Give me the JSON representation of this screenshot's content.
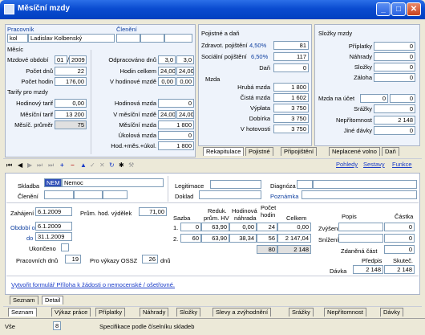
{
  "window": {
    "title": "Měsíční mzdy"
  },
  "top": {
    "pracovnik_label": "Pracovník",
    "cleneni_label": "Členění",
    "kod": "kol",
    "jmeno": "Ladislav Kolbenský",
    "mesic_label": "Měsíc",
    "mzdove_obdobi_label": "Mzdové období",
    "obdobi_mesic": "01",
    "obdobi_rok": "2009",
    "pocet_dnu_label": "Počet dnů",
    "pocet_dnu": "22",
    "pocet_hodin_label": "Počet hodin",
    "pocet_hodin": "176,00",
    "tarify_label": "Tarify pro mzdy",
    "hodinovy_tarif_label": "Hodinový tarif",
    "hodinovy_tarif": "0,00",
    "mesicni_tarif_label": "Měsíční tarif",
    "mesicni_tarif": "13 200",
    "mesic_prumer_label": "Měsíč. průměr",
    "mesic_prumer": "75",
    "odpracovano_dnu_label": "Odpracováno dnů",
    "odpracovano_dnu_a": "3,0",
    "odpracovano_dnu_b": "3,0",
    "hodin_celkem_label": "Hodin celkem",
    "hodin_celkem_a": "24,00",
    "hodin_celkem_b": "24,00",
    "v_hodinove_mzde_label": "V hodinové mzdě",
    "v_hodinove_mzde_a": "0,00",
    "v_hodinove_mzde_b": "0,00",
    "hodinova_mzda_label": "Hodinová mzda",
    "hodinova_mzda": "0",
    "v_mesicni_mzde_label": "V měsíční mzdě",
    "v_mesicni_mzde_a": "24,00",
    "v_mesicni_mzde_b": "24,00",
    "mesicni_mzda_label": "Měsíční mzda",
    "mesicni_mzda": "1 800",
    "ukolova_mzda_label": "Úkolová mzda",
    "ukolova_mzda": "0",
    "hod_mes_ukol_label": "Hod.+měs.+úkol.",
    "hod_mes_ukol": "1 800"
  },
  "pojistne": {
    "title": "Pojistné a daň",
    "zdrav_label": "Zdravot. pojištění",
    "zdrav_pct": "4,50%",
    "zdrav": "81",
    "soc_label": "Sociální pojištění",
    "soc_pct": "6,50%",
    "soc": "117",
    "dan_label": "Daň",
    "dan": "0",
    "mzda_label": "Mzda",
    "hruba_label": "Hrubá mzda",
    "hruba": "1 800",
    "cista_label": "Čistá mzda",
    "cista": "1 602",
    "vyplata_label": "Výplata",
    "vyplata": "3 750",
    "dobirka_label": "Dobírka",
    "dobirka": "3 750",
    "hotovosti_label": "V hotovosti",
    "hotovosti": "3 750"
  },
  "slozky": {
    "title": "Složky mzdy",
    "priplatky_label": "Příplatky",
    "priplatky": "0",
    "nahrady_label": "Náhrady",
    "nahrady": "0",
    "slozky_label": "Složky",
    "slozky": "0",
    "zaloha_label": "Záloha",
    "zaloha": "0",
    "mzda_na_ucet_label": "Mzda na účet",
    "mzda_na_ucet_a": "0",
    "mzda_na_ucet_b": "0",
    "srazky_label": "Srážky",
    "srazky": "0",
    "nepritomnost_label": "Nepřítomnost",
    "nepritomnost": "2 148",
    "jine_davky_label": "Jiné dávky",
    "jine_davky": "0"
  },
  "top_tabs": [
    "Rekapitulace",
    "Pojistné",
    "Připojištění",
    "Neplacené volno",
    "Daň"
  ],
  "toolbar_links": [
    "Pohledy",
    "Sestavy",
    "Funkce"
  ],
  "detail": {
    "skladba_label": "Skladba",
    "skladba_code": "NEM",
    "skladba_name": "Nemoc",
    "cleneni_label": "Členění",
    "legitimace_label": "Legitimace",
    "doklad_label": "Doklad",
    "diagnoza_label": "Diagnóza",
    "poznamka_label": "Poznámka",
    "zahajeni_label": "Zahájení",
    "zahajeni": "6.1.2009",
    "prum_vydelek_label": "Prům. hod. výdělek",
    "prum_vydelek": "71,00",
    "obdobi_od_label": "Období od",
    "obdobi_od": "6.1.2009",
    "do_label": "do",
    "obdobi_do": "31.1.2009",
    "ukonceno_label": "Ukončeno",
    "pracovnich_dnu_label": "Pracovních dnů",
    "pracovnich_dnu": "19",
    "pro_vykazy_label": "Pro výkazy OSSZ",
    "pro_vykazy": "26",
    "dnu_label": "dnů",
    "sazba_label": "Sazba",
    "reduk_label": "Reduk.",
    "prum_hv_label": "prům. HV",
    "hodinova_label": "Hodinová",
    "nahrada_label": "náhrada",
    "pocet_label": "Počet",
    "hodin_label": "hodin",
    "celkem_label": "Celkem",
    "rows": [
      {
        "idx": "1.",
        "sazba": "0",
        "reduk": "63,90",
        "nahrada": "0,00",
        "hodin": "24",
        "celkem": "0,00"
      },
      {
        "idx": "2.",
        "sazba": "60",
        "reduk": "63,90",
        "nahrada": "38,34",
        "hodin": "56",
        "celkem": "2 147,04"
      }
    ],
    "sum_hodin": "80",
    "sum_celkem": "2 148",
    "popis_label": "Popis",
    "castka_label": "Částka",
    "zvyseni_label": "Zvýšení",
    "zvyseni": "0",
    "snizeni_label": "Snížení",
    "snizeni": "0",
    "zdanena_label": "Zdaněná část",
    "zdanena": "0",
    "predpis_label": "Předpis",
    "skutec_label": "Skuteč.",
    "davka_label": "Dávka",
    "davka_predpis": "2 148",
    "davka_skutec": "2 148",
    "link": "Vytvořit formulář Příloha k žádosti o nemocenské / ošetřovné."
  },
  "view_tabs": [
    "Seznam",
    "Detail"
  ],
  "bottom_tabs": [
    "Seznam",
    "Výkaz práce",
    "Příplatky",
    "Náhrady",
    "Složky",
    "Slevy a zvýhodnění",
    "Srážky",
    "Nepřítomnost",
    "Dávky"
  ],
  "status": {
    "left": "Vše",
    "mid": "8",
    "text": "Specifikace podle číselníku skladeb"
  }
}
